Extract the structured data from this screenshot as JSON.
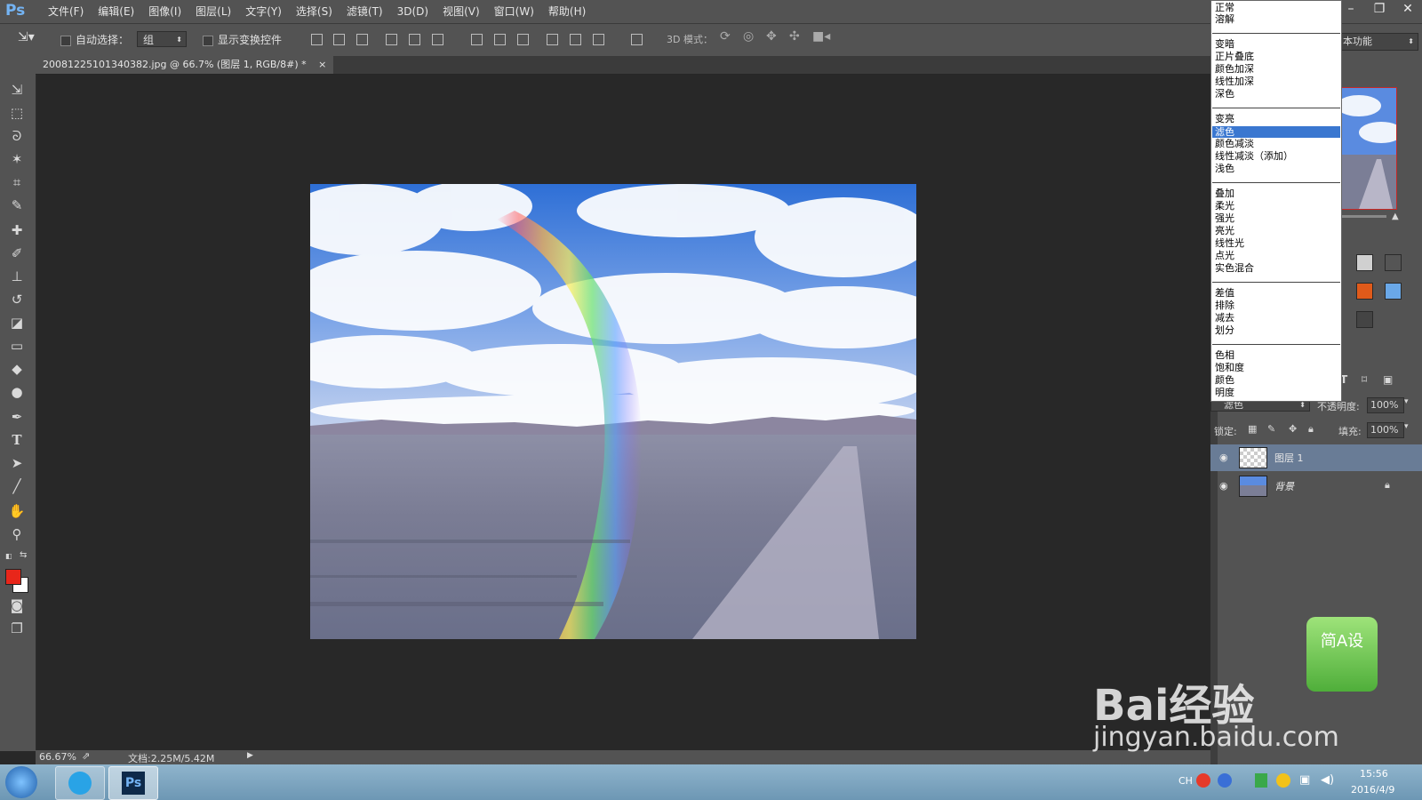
{
  "app": {
    "logo": "Ps"
  },
  "menu": [
    "文件(F)",
    "编辑(E)",
    "图像(I)",
    "图层(L)",
    "文字(Y)",
    "选择(S)",
    "滤镜(T)",
    "3D(D)",
    "视图(V)",
    "窗口(W)",
    "帮助(H)"
  ],
  "window_controls": {
    "minimize": "–",
    "restore": "❐",
    "close": "✕"
  },
  "options": {
    "auto_select_label": "自动选择：",
    "auto_select_value": "组",
    "show_transform_label": "显示变换控件",
    "mode_3d_label": "3D 模式：",
    "workspace": "本功能"
  },
  "document_tab": {
    "title": "20081225101340382.jpg @ 66.7% (图层 1, RGB/8#) *",
    "close": "×"
  },
  "status": {
    "zoom": "66.67%",
    "doc_info": "文档:2.25M/5.42M"
  },
  "blend_modes": {
    "groups": [
      [
        "正常",
        "溶解"
      ],
      [
        "变暗",
        "正片叠底",
        "颜色加深",
        "线性加深",
        "深色"
      ],
      [
        "变亮",
        "滤色",
        "颜色减淡",
        "线性减淡（添加）",
        "浅色"
      ],
      [
        "叠加",
        "柔光",
        "强光",
        "亮光",
        "线性光",
        "点光",
        "实色混合"
      ],
      [
        "差值",
        "排除",
        "减去",
        "划分"
      ],
      [
        "色相",
        "饱和度",
        "颜色",
        "明度"
      ]
    ],
    "selected": "滤色"
  },
  "layers_panel": {
    "blend_value": "滤色",
    "opacity_label": "不透明度:",
    "opacity_value": "100%",
    "lock_label": "锁定:",
    "fill_label": "填充:",
    "fill_value": "100%",
    "layers": [
      {
        "name": "图层 1",
        "selected": true,
        "locked": false
      },
      {
        "name": "背景",
        "selected": false,
        "locked": true
      }
    ]
  },
  "taskbar": {
    "lang": "CH",
    "time": "15:56",
    "date": "2016/4/9"
  },
  "watermark": {
    "brand": "Bai经验",
    "url": "jingyan.baidu.com",
    "badge": "简A设"
  },
  "colors": {
    "foreground": "#e8261a",
    "background": "#ffffff",
    "accent": "#3a77d0"
  }
}
